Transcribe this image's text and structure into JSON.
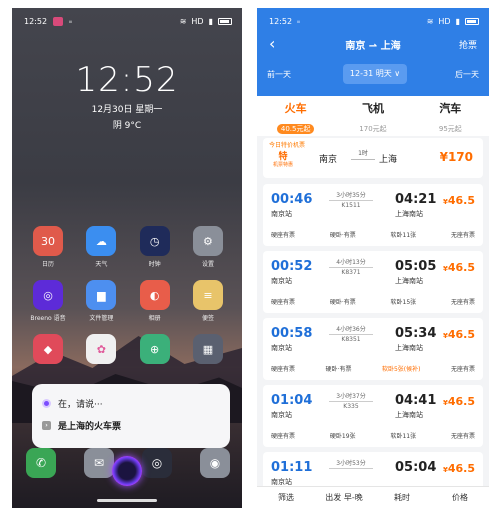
{
  "left_phone": {
    "status": {
      "time": "12:52",
      "carrier": "ᵢᵢᵢ",
      "signal": "HD"
    },
    "lock": {
      "clock": "12:52",
      "date": "12月30日 星期一",
      "weather": "阴 9°C"
    },
    "apps_row1": [
      {
        "label": "日历",
        "glyph": "30",
        "color": "#e05a4b"
      },
      {
        "label": "天气",
        "glyph": "☁",
        "color": "#3b8ef0"
      },
      {
        "label": "时钟",
        "glyph": "◷",
        "color": "#1f2b5a"
      },
      {
        "label": "设置",
        "glyph": "⚙",
        "color": "#8a8f99"
      }
    ],
    "apps_row2": [
      {
        "label": "Breeno 语音",
        "glyph": "◎",
        "color": "#5d2bd8"
      },
      {
        "label": "文件管理",
        "glyph": "▆",
        "color": "#4d8ff0"
      },
      {
        "label": "相册",
        "glyph": "◐",
        "color": "#e85d4a"
      },
      {
        "label": "便签",
        "glyph": "≡",
        "color": "#e8c46a"
      }
    ],
    "apps_row3": [
      {
        "label": "",
        "glyph": "◆",
        "color": "#e04a5a"
      },
      {
        "label": "",
        "glyph": "✿",
        "color": "#f0f0f0"
      },
      {
        "label": "",
        "glyph": "⊕",
        "color": "#3bb07a",
        "badge": "2"
      },
      {
        "label": "",
        "glyph": "▦",
        "color": "#5a6070"
      }
    ],
    "assistant": {
      "line1": "在，请说···",
      "line2": "是上海的火车票"
    },
    "dock": [
      {
        "glyph": "✆",
        "color": "#3aa655"
      },
      {
        "glyph": "✉",
        "color": "#8a8f99",
        "badge": "3"
      },
      {
        "glyph": "◎",
        "color": "#2a2d3a"
      },
      {
        "glyph": "◉",
        "color": "#8a8f99"
      }
    ]
  },
  "right_phone": {
    "status": {
      "time": "12:52",
      "carrier": "ᵢᵢᵢ",
      "signal": "HD"
    },
    "header": {
      "route": "南京 ⇀ 上海",
      "grab": "抢票",
      "prev_day": "前一天",
      "date": "12-31 明天 ∨",
      "next_day": "后一天"
    },
    "tabs": [
      {
        "label": "火车",
        "sub": "40.5元起",
        "active": true
      },
      {
        "label": "飞机",
        "sub": "170元起",
        "active": false
      },
      {
        "label": "汽车",
        "sub": "95元起",
        "active": false
      }
    ],
    "special": {
      "tag": "今日特价机票",
      "logo_line": "特",
      "logo_sub": "机票特惠",
      "from": "南京",
      "duration": "1时",
      "to": "上海",
      "price": "¥170"
    },
    "trains": [
      {
        "dep": "00:46",
        "dep_st": "南京站",
        "dur": "3小时35分",
        "no": "K1511",
        "arr": "04:21",
        "arr_st": "上海南站",
        "price": "46.5",
        "seats": [
          "硬座有票",
          "硬卧·有票",
          "软卧11张",
          "无座有票"
        ]
      },
      {
        "dep": "00:52",
        "dep_st": "南京站",
        "dur": "4小时13分",
        "no": "K8371",
        "arr": "05:05",
        "arr_st": "上海南站",
        "price": "46.5",
        "seats": [
          "硬座有票",
          "硬卧·有票",
          "软卧15张",
          "无座有票"
        ]
      },
      {
        "dep": "00:58",
        "dep_st": "南京站",
        "dur": "4小时36分",
        "no": "K8351",
        "arr": "05:34",
        "arr_st": "上海南站",
        "price": "46.5",
        "seats": [
          "硬座有票",
          "硬卧·有票",
          "软卧5张(候补)",
          "无座有票"
        ]
      },
      {
        "dep": "01:04",
        "dep_st": "南京站",
        "dur": "3小时37分",
        "no": "K335",
        "arr": "04:41",
        "arr_st": "上海南站",
        "price": "46.5",
        "seats": [
          "硬座有票",
          "硬卧19张",
          "软卧11张",
          "无座有票"
        ]
      },
      {
        "dep": "01:11",
        "dep_st": "南京站",
        "dur": "3小时53分",
        "no": "",
        "arr": "05:04",
        "arr_st": "",
        "price": "46.5",
        "seats": [
          "",
          "",
          "",
          ""
        ]
      }
    ],
    "bottom": [
      "筛选",
      "出发 早-晚",
      "耗时",
      "价格"
    ]
  }
}
